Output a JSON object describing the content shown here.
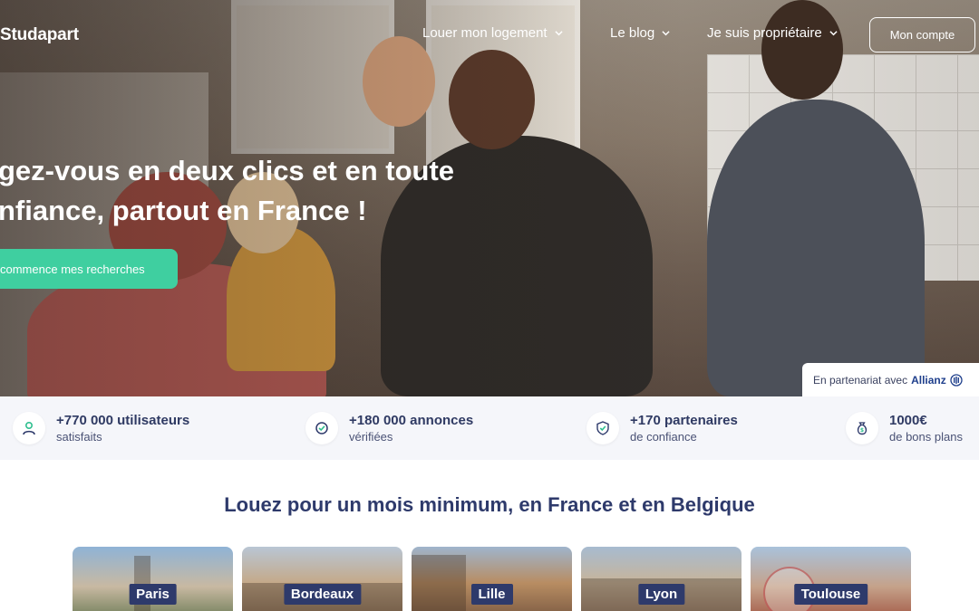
{
  "brand": {
    "name": "Studapart"
  },
  "nav": {
    "items": [
      {
        "label": "Louer mon logement"
      },
      {
        "label": "Le blog"
      },
      {
        "label": "Je suis propriétaire"
      }
    ],
    "account_label": "Mon compte"
  },
  "hero": {
    "headline_line1": "gez-vous en deux clics et en toute",
    "headline_line2": "nfiance, partout en France !",
    "cta_label": "commence mes recherches",
    "partner_text": "En partenariat avec",
    "partner_brand": "Allianz"
  },
  "stats": [
    {
      "value": "+770 000 utilisateurs",
      "caption": "satisfaits",
      "icon": "user-icon"
    },
    {
      "value": "+180 000 annonces",
      "caption": "vérifiées",
      "icon": "check-circle-icon"
    },
    {
      "value": "+170 partenaires",
      "caption": "de confiance",
      "icon": "shield-check-icon"
    },
    {
      "value": "1000€",
      "caption": "de bons plans",
      "icon": "money-bag-icon"
    }
  ],
  "section": {
    "title": "Louez pour un mois minimum, en France et en Belgique"
  },
  "cities": [
    {
      "name": "Paris"
    },
    {
      "name": "Bordeaux"
    },
    {
      "name": "Lille"
    },
    {
      "name": "Lyon"
    },
    {
      "name": "Toulouse"
    }
  ],
  "colors": {
    "accent": "#3fcfa0",
    "navy": "#2e3a6b",
    "stats_bg": "#f5f6fa"
  }
}
